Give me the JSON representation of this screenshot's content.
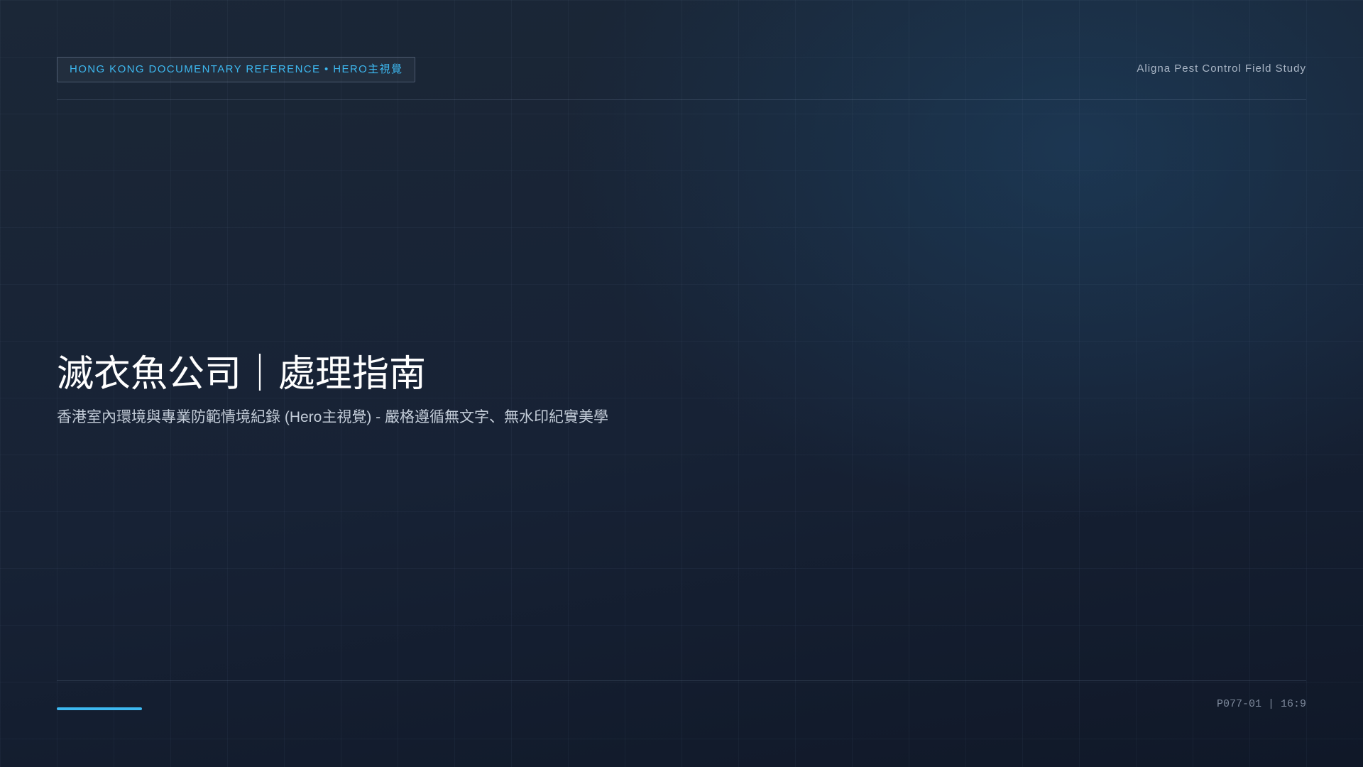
{
  "header": {
    "tag": "HONG KONG DOCUMENTARY REFERENCE • HERO主視覺",
    "brand": "Aligna Pest Control Field Study"
  },
  "hero": {
    "title": "滅衣魚公司｜處理指南",
    "subtitle": "香港室內環境與專業防範情境紀錄 (Hero主視覺) - 嚴格遵循無文字、無水印紀實美學"
  },
  "footer": {
    "code": "P077-01 | 16:9"
  },
  "colors": {
    "accent": "#3db8f0",
    "background": "#172235",
    "title": "#ffffff",
    "subtitle": "#c3ccd8",
    "muted": "#7e8a9c"
  }
}
